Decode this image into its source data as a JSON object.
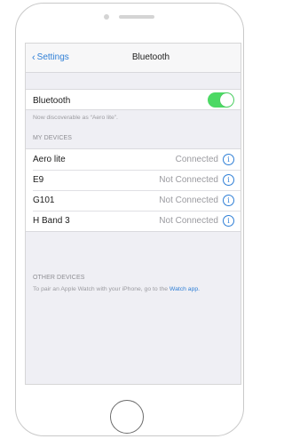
{
  "navbar": {
    "back_label": "Settings",
    "title": "Bluetooth"
  },
  "bluetooth": {
    "label": "Bluetooth",
    "enabled": true,
    "discoverable_note": "Now discoverable as “Aero lite”."
  },
  "my_devices": {
    "header": "MY DEVICES",
    "items": [
      {
        "name": "Aero lite",
        "status": "Connected"
      },
      {
        "name": "E9",
        "status": "Not Connected"
      },
      {
        "name": "G101",
        "status": "Not Connected"
      },
      {
        "name": "H Band 3",
        "status": "Not Connected"
      }
    ]
  },
  "other_devices": {
    "header": "OTHER DEVICES",
    "note": "To pair an Apple Watch with your iPhone, go to the",
    "link": "Watch app."
  },
  "colors": {
    "accent": "#2f7fd6",
    "toggle_on": "#4cd964",
    "background": "#efeff4"
  },
  "icons": {
    "back": "chevron-left-icon",
    "info": "info-icon"
  }
}
